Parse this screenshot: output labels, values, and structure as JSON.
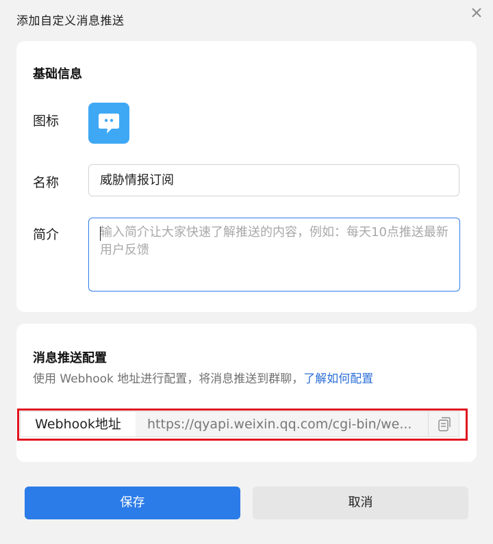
{
  "dialog": {
    "title": "添加自定义消息推送"
  },
  "basic_info": {
    "section_title": "基础信息",
    "icon_label": "图标",
    "icon_name": "chat-bubble-icon",
    "icon_color": "#3fa8f5",
    "name_label": "名称",
    "name_value": "威胁情报订阅",
    "desc_label": "简介",
    "desc_placeholder": "输入简介让大家快速了解推送的内容，例如：每天10点推送最新用户反馈"
  },
  "push_config": {
    "section_title": "消息推送配置",
    "hint_text": "使用 Webhook 地址进行配置，将消息推送到群聊，",
    "hint_link": "了解如何配置",
    "webhook_label": "Webhook地址",
    "webhook_url": "https://qyapi.weixin.qq.com/cgi-bin/we...",
    "copy_icon": "copy-icon",
    "highlight_color": "#e0141e"
  },
  "actions": {
    "save_label": "保存",
    "cancel_label": "取消",
    "primary_color": "#2b7be8"
  }
}
